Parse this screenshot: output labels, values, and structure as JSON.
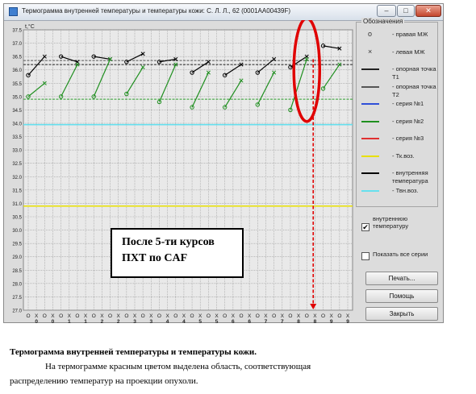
{
  "window": {
    "title": "Термограмма внутренней температуры и температуры кожи:  С. Л. Л., 62 (0001АА00439F)",
    "min_glyph": "–",
    "max_glyph": "□",
    "close_glyph": "✕"
  },
  "chart_data": {
    "type": "line",
    "ylabel": "t,°C",
    "ylim": [
      27.0,
      37.5
    ],
    "yticks": [
      "37.5",
      "37.0",
      "36.5",
      "36.0",
      "35.5",
      "35.0",
      "34.5",
      "34.0",
      "33.5",
      "33.0",
      "32.5",
      "32.0",
      "31.5",
      "31.0",
      "30.5",
      "30.0",
      "29.5",
      "29.0",
      "28.5",
      "28.0",
      "27.5",
      "27.0"
    ],
    "x_markers": [
      "O",
      "X",
      "O",
      "X",
      "O",
      "X",
      "O",
      "X",
      "O",
      "X",
      "O",
      "X",
      "O",
      "X",
      "O",
      "X",
      "O",
      "X",
      "O",
      "X",
      "O",
      "X",
      "O",
      "X",
      "O",
      "X",
      "O",
      "X",
      "O",
      "X",
      "O",
      "X",
      "O",
      "X",
      "O",
      "X",
      "O",
      "X",
      "O",
      "X"
    ],
    "x_numbers": [
      "0",
      "0",
      "1",
      "1",
      "2",
      "2",
      "3",
      "3",
      "4",
      "4",
      "5",
      "5",
      "6",
      "6",
      "7",
      "7",
      "8",
      "8",
      "9",
      "9"
    ],
    "reference_lines": [
      {
        "name": "Тк.воз.",
        "value": 30.9,
        "color": "#e8e000"
      },
      {
        "name": "Твн.воз.",
        "value": 33.95,
        "color": "#66e0ee"
      },
      {
        "name": "опорная точка Т1",
        "value": 36.2,
        "color": "#222222"
      },
      {
        "name": "опорная точка Т2",
        "value": 36.35,
        "color": "#555555"
      },
      {
        "name": "опорная точка зелёная",
        "value": 34.9,
        "color": "#2e9e2e"
      }
    ],
    "series": [
      {
        "name": "внутренняя температура",
        "color": "#000000",
        "segments": [
          {
            "x": [
              0,
              1
            ],
            "y": [
              35.8,
              36.5
            ]
          },
          {
            "x": [
              2,
              3
            ],
            "y": [
              36.5,
              36.3
            ]
          },
          {
            "x": [
              4,
              5
            ],
            "y": [
              36.5,
              36.4
            ]
          },
          {
            "x": [
              6,
              7
            ],
            "y": [
              36.3,
              36.6
            ]
          },
          {
            "x": [
              8,
              9
            ],
            "y": [
              36.3,
              36.4
            ]
          },
          {
            "x": [
              10,
              11
            ],
            "y": [
              35.9,
              36.3
            ]
          },
          {
            "x": [
              12,
              13
            ],
            "y": [
              35.8,
              36.2
            ]
          },
          {
            "x": [
              14,
              15
            ],
            "y": [
              35.9,
              36.4
            ]
          },
          {
            "x": [
              16,
              17
            ],
            "y": [
              36.1,
              36.5
            ]
          },
          {
            "x": [
              18,
              19
            ],
            "y": [
              36.9,
              36.8
            ]
          }
        ]
      },
      {
        "name": "серия №2",
        "color": "#1f8f1f",
        "segments": [
          {
            "x": [
              0,
              1
            ],
            "y": [
              35.0,
              35.5
            ]
          },
          {
            "x": [
              2,
              3
            ],
            "y": [
              35.0,
              36.2
            ]
          },
          {
            "x": [
              4,
              5
            ],
            "y": [
              35.0,
              36.4
            ]
          },
          {
            "x": [
              6,
              7
            ],
            "y": [
              35.1,
              36.1
            ]
          },
          {
            "x": [
              8,
              9
            ],
            "y": [
              34.8,
              36.2
            ]
          },
          {
            "x": [
              10,
              11
            ],
            "y": [
              34.6,
              35.9
            ]
          },
          {
            "x": [
              12,
              13
            ],
            "y": [
              34.6,
              35.6
            ]
          },
          {
            "x": [
              14,
              15
            ],
            "y": [
              34.7,
              35.9
            ]
          },
          {
            "x": [
              16,
              17
            ],
            "y": [
              34.5,
              36.4
            ]
          },
          {
            "x": [
              18,
              19
            ],
            "y": [
              35.3,
              36.2
            ]
          }
        ]
      }
    ],
    "highlight": {
      "x_index": 17,
      "y": 36.0,
      "color": "#e00000"
    }
  },
  "legend": {
    "title": "Обозначения",
    "items": [
      {
        "symbol": "o",
        "label": "- правая МЖ",
        "kind": "symbol"
      },
      {
        "symbol": "×",
        "label": "- левая МЖ",
        "kind": "symbol"
      },
      {
        "symbol": "",
        "label": "- опорная точка Т1",
        "kind": "line",
        "color": "#222222"
      },
      {
        "symbol": "",
        "label": "- опорная точка Т2",
        "kind": "line",
        "color": "#555555"
      },
      {
        "symbol": "",
        "label": "- серия №1",
        "kind": "line",
        "color": "#2f4fd8"
      },
      {
        "symbol": "",
        "label": "- серия №2",
        "kind": "line",
        "color": "#1f8f1f"
      },
      {
        "symbol": "",
        "label": "- серия №3",
        "kind": "line",
        "color": "#e03030"
      },
      {
        "symbol": "",
        "label": "- Тк.воз.",
        "kind": "line",
        "color": "#e8e000"
      },
      {
        "symbol": "",
        "label": "- внутренняя температура",
        "kind": "line",
        "color": "#000000"
      },
      {
        "symbol": "",
        "label": "- Твн.воз.",
        "kind": "line",
        "color": "#66e0ee"
      }
    ]
  },
  "controls": {
    "chk_internal_label": "внутреннюю температуру",
    "chk_internal_checked": true,
    "chk_all_label": "Показать все серии",
    "chk_all_checked": false,
    "print_label": "Печать...",
    "help_label": "Помощь",
    "close_label": "Закрыть"
  },
  "overlay": {
    "line1": "После 5-ти курсов",
    "line2": "ПХТ по CAF"
  },
  "caption": {
    "line1": "Термограмма  внутренней температуры и  температуры кожи.",
    "line2": "На термограмме красным цветом выделена область, соответствующая",
    "line3": "распределению температур на проекции опухоли."
  }
}
